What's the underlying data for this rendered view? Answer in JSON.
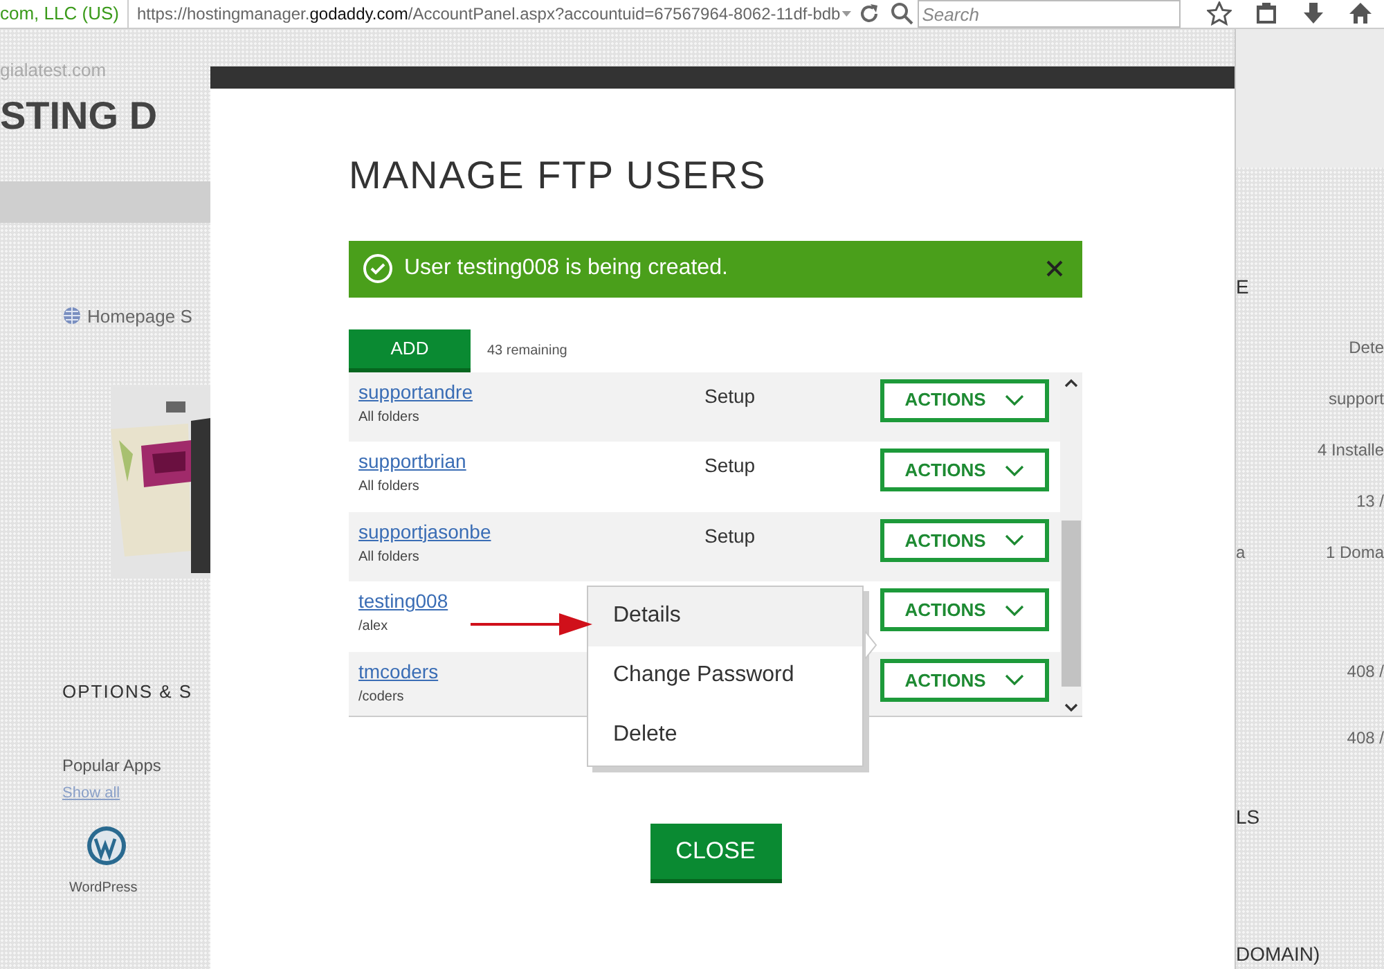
{
  "browser": {
    "identity": "com, LLC (US)",
    "url": "https://hostingmanager.**godaddy.com**/AccountPanel.aspx?accountuid=67567964-8062-11df-bdb",
    "search": {
      "placeholder": "Search"
    }
  },
  "background_page": {
    "left": [
      {
        "kind": "site",
        "text": "gialatest.com"
      },
      {
        "kind": "heading",
        "text": "STING D"
      },
      {
        "kind": "card-title",
        "text": "Homepage S"
      },
      {
        "kind": "picture"
      },
      {
        "kind": "section",
        "text": "OPTIONS & S"
      },
      {
        "kind": "label",
        "text": "Popular Apps"
      },
      {
        "kind": "link",
        "text": "Show all"
      },
      {
        "kind": "app",
        "text": "WordPress"
      }
    ],
    "right": [
      {
        "kind": "section",
        "text": "E"
      },
      {
        "kind": "value",
        "text": "Dete"
      },
      {
        "kind": "value",
        "text": "support"
      },
      {
        "kind": "value",
        "text": "4 Installe"
      },
      {
        "kind": "value",
        "text": "13 /"
      },
      {
        "kind": "pair",
        "text": "a",
        "value": "1 Doma"
      },
      {
        "kind": "value",
        "text": "408 /"
      },
      {
        "kind": "value",
        "text": "408 /"
      },
      {
        "kind": "section",
        "text": "LS"
      },
      {
        "kind": "section",
        "text": "DOMAIN)"
      }
    ]
  },
  "modal": {
    "title": "MANAGE FTP USERS",
    "alert": {
      "message": "User testing008 is being created."
    },
    "add_button": "ADD",
    "remaining": "43 remaining",
    "users": [
      {
        "name": "supportandre",
        "folder": "All folders",
        "status": "Setup",
        "action": "ACTIONS"
      },
      {
        "name": "supportbrian",
        "folder": "All folders",
        "status": "Setup",
        "action": "ACTIONS"
      },
      {
        "name": "supportjasonbe",
        "folder": "All folders",
        "status": "Setup",
        "action": "ACTIONS"
      },
      {
        "name": "testing008",
        "folder": "/alex",
        "action": "ACTIONS"
      },
      {
        "name": "tmcoders",
        "folder": "/coders",
        "action": "ACTIONS"
      }
    ],
    "menu": [
      {
        "label": "Details",
        "selected": true
      },
      {
        "label": "Change Password",
        "selected": false
      },
      {
        "label": "Delete",
        "selected": false
      }
    ],
    "close_button": "CLOSE"
  }
}
